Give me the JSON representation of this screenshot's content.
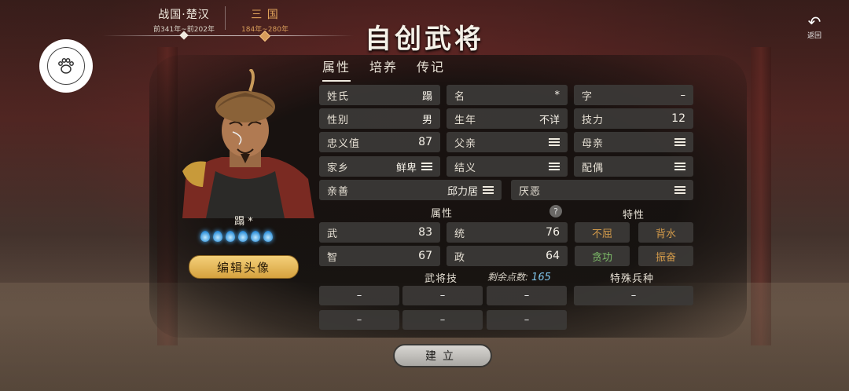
{
  "eras": [
    {
      "name": "战国·楚汉",
      "years": "前341年~前202年"
    },
    {
      "name": "三 国",
      "years": "184年~280年"
    }
  ],
  "title": "自创武将",
  "back_label": "返回",
  "tabs": [
    "属性",
    "培养",
    "传记"
  ],
  "active_tab": "属性",
  "general": {
    "name_label": "蹋 *",
    "edit_avatar": "编辑头像",
    "drop_count": 6
  },
  "fields": {
    "surname": {
      "label": "姓氏",
      "value": "蹋"
    },
    "given_name": {
      "label": "名",
      "value": "*"
    },
    "courtesy": {
      "label": "字",
      "value": "–"
    },
    "gender": {
      "label": "性别",
      "value": "男"
    },
    "birth_year": {
      "label": "生年",
      "value": "不详"
    },
    "skill_points": {
      "label": "技力",
      "value": "12"
    },
    "loyalty": {
      "label": "忠义值",
      "value": "87"
    },
    "father": {
      "label": "父亲"
    },
    "mother": {
      "label": "母亲"
    },
    "hometown": {
      "label": "家乡",
      "value": "鲜卑"
    },
    "sworn": {
      "label": "结义"
    },
    "spouse": {
      "label": "配偶"
    },
    "likes": {
      "label": "亲善",
      "value": "邱力居"
    },
    "dislikes": {
      "label": "厌恶"
    }
  },
  "attributes_header": "属性",
  "traits_header": "特性",
  "attributes": [
    {
      "label": "武",
      "value": "83"
    },
    {
      "label": "统",
      "value": "76"
    },
    {
      "label": "智",
      "value": "67"
    },
    {
      "label": "政",
      "value": "64"
    }
  ],
  "traits": [
    {
      "label": "不屈",
      "color": "#d29a4a"
    },
    {
      "label": "背水",
      "color": "#d29a4a"
    },
    {
      "label": "贪功",
      "color": "#7fbf6a"
    },
    {
      "label": "振奋",
      "color": "#d29a4a"
    }
  ],
  "skills_header": "武将技",
  "remaining_label": "剩余点数:",
  "remaining_value": "165",
  "special_troop_header": "特殊兵种",
  "skill_slots": [
    "–",
    "–",
    "–",
    "–",
    "–",
    "–"
  ],
  "special_troop": "–",
  "create_label": "建立"
}
